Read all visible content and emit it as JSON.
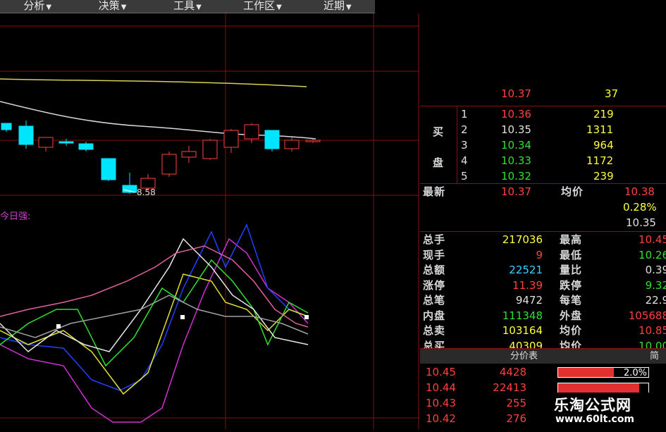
{
  "menu": [
    {
      "label": "分析"
    },
    {
      "label": "决策"
    },
    {
      "label": "工具"
    },
    {
      "label": "工作区"
    },
    {
      "label": "近期"
    }
  ],
  "menu_arrow": "▼",
  "chart": {
    "low_annotation": "8.58",
    "indicator_label": "今日强:",
    "colors": {
      "up": "#ff4040",
      "down": "#00e5ff",
      "ma_slow": "#d8d050",
      "ma_fast": "#d8d8d8",
      "grid": "#8a1010"
    }
  },
  "quote": {
    "buy_label_1": "买",
    "buy_label_2": "盘",
    "partial_row": {
      "price": "10.37",
      "vol": "37"
    },
    "bids": [
      {
        "level": "1",
        "price": "10.36",
        "vol": "219",
        "price_color": "red"
      },
      {
        "level": "2",
        "price": "10.35",
        "vol": "1311",
        "price_color": "white"
      },
      {
        "level": "3",
        "price": "10.34",
        "vol": "964",
        "price_color": "green"
      },
      {
        "level": "4",
        "price": "10.33",
        "vol": "1172",
        "price_color": "green"
      },
      {
        "level": "5",
        "price": "10.32",
        "vol": "239",
        "price_color": "green"
      }
    ],
    "latest_label": "最新",
    "latest": "10.37",
    "avg_label": "均价",
    "avg": "10.38",
    "change_pct": "0.28%",
    "prev_close": "10.35",
    "stats": [
      {
        "l1": "总手",
        "v1": "217036",
        "c1": "yellow",
        "l2": "最高",
        "v2": "10.45",
        "c2": "red"
      },
      {
        "l1": "现手",
        "v1": "9",
        "c1": "red",
        "l2": "最低",
        "v2": "10.26",
        "c2": "green"
      },
      {
        "l1": "总额",
        "v1": "22521",
        "c1": "cyan",
        "l2": "量比",
        "v2": "0.39",
        "c2": "white"
      },
      {
        "l1": "涨停",
        "v1": "11.39",
        "c1": "red",
        "l2": "跌停",
        "v2": "9.32",
        "c2": "green"
      },
      {
        "l1": "总笔",
        "v1": "9472",
        "c1": "white",
        "l2": "每笔",
        "v2": "22.9",
        "c2": "white"
      },
      {
        "l1": "内盘",
        "v1": "111348",
        "c1": "green",
        "l2": "外盘",
        "v2": "105688",
        "c2": "red"
      },
      {
        "l1": "总卖",
        "v1": "103164",
        "c1": "yellow",
        "l2": "均价",
        "v2": "10.85",
        "c2": "red"
      },
      {
        "l1": "总买",
        "v1": "40309",
        "c1": "yellow",
        "l2": "均价",
        "v2": "10.00",
        "c2": "green"
      }
    ],
    "tab_label": "分价表",
    "tab_short": "简",
    "price_table": [
      {
        "price": "10.45",
        "vol": "4428",
        "pct": "2.0%",
        "fill": 0.62
      },
      {
        "price": "10.44",
        "vol": "22413",
        "pct": "",
        "fill": 0.9
      },
      {
        "price": "10.43",
        "vol": "255",
        "pct": "",
        "fill": 0
      },
      {
        "price": "10.42",
        "vol": "276",
        "pct": "",
        "fill": 0
      }
    ]
  },
  "watermark": {
    "line1": "乐淘公式网",
    "line2": "www.60lt.com"
  }
}
